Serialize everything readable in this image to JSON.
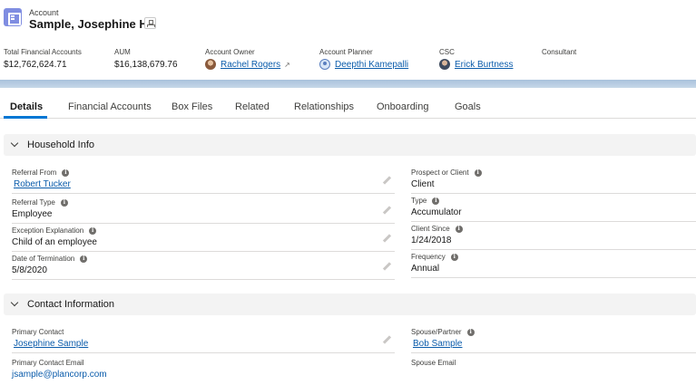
{
  "header": {
    "object_label": "Account",
    "record_name": "Sample, Josephine HH",
    "fields": {
      "total_financial_accounts": {
        "label": "Total Financial Accounts",
        "value": "$12,762,624.71"
      },
      "aum": {
        "label": "AUM",
        "value": "$16,138,679.76"
      },
      "account_owner": {
        "label": "Account Owner",
        "value": "Rachel Rogers"
      },
      "account_planner": {
        "label": "Account Planner",
        "value": "Deepthi Kamepalli"
      },
      "csc": {
        "label": "CSC",
        "value": "Erick Burtness"
      },
      "consultant": {
        "label": "Consultant",
        "value": ""
      }
    }
  },
  "tabs": [
    {
      "label": "Details",
      "active": true
    },
    {
      "label": "Financial Accounts"
    },
    {
      "label": "Box Files"
    },
    {
      "label": "Related"
    },
    {
      "label": "Relationships"
    },
    {
      "label": "Onboarding"
    },
    {
      "label": "Goals"
    }
  ],
  "household_info": {
    "title": "Household Info",
    "left": [
      {
        "label": "Referral From",
        "value": "Robert Tucker",
        "is_link": true
      },
      {
        "label": "Referral Type",
        "value": "Employee"
      },
      {
        "label": "Exception Explanation",
        "value": "Child of an employee"
      },
      {
        "label": "Date of Termination",
        "value": "5/8/2020"
      }
    ],
    "right": [
      {
        "label": "Prospect or Client",
        "value": "Client"
      },
      {
        "label": "Type",
        "value": "Accumulator"
      },
      {
        "label": "Client Since",
        "value": "1/24/2018"
      },
      {
        "label": "Frequency",
        "value": "Annual"
      }
    ]
  },
  "contact_info": {
    "title": "Contact Information",
    "left": [
      {
        "label": "Primary Contact",
        "value": "Josephine Sample",
        "is_link": true
      },
      {
        "label": "Primary Contact Email",
        "value": "jsample@plancorp.com",
        "is_link": true
      }
    ],
    "right": [
      {
        "label": "Spouse/Partner",
        "value": "Bob Sample",
        "is_link": true
      },
      {
        "label": "Spouse Email",
        "value": ""
      }
    ]
  },
  "colors": {
    "link": "#0b5cab",
    "tab_active": "#0176d3",
    "section_bg": "#f3f3f3",
    "object_icon": "#7f8de1"
  },
  "icons": {
    "object": "account-icon",
    "hierarchy": "hierarchy-icon",
    "info": "info-icon",
    "edit": "pencil-icon",
    "collapse": "chevron-down-icon"
  }
}
